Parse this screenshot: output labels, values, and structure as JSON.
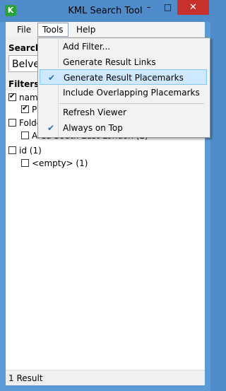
{
  "window": {
    "title": "KML Search Tool",
    "icon": "kml-app-icon",
    "controls": {
      "min": "–",
      "max": "□",
      "close": "✕"
    }
  },
  "menubar": {
    "items": [
      "File",
      "Tools",
      "Help"
    ]
  },
  "search": {
    "label": "Search",
    "value": "Belve"
  },
  "filters": {
    "label": "Filters",
    "tree": [
      {
        "label": "name",
        "checked": true,
        "level": 0
      },
      {
        "label": "P",
        "checked": true,
        "level": 1
      },
      {
        "label": "Folde",
        "checked": false,
        "level": 0
      },
      {
        "label": "Area South East London (1)",
        "checked": false,
        "level": 1
      },
      {
        "label": "id (1)",
        "checked": false,
        "level": 0
      },
      {
        "label": "<empty> (1)",
        "checked": false,
        "level": 1
      }
    ]
  },
  "tools_menu": {
    "items": [
      {
        "label": "Add Filter...",
        "checked": false
      },
      {
        "label": "Generate Result Links",
        "checked": false
      },
      {
        "label": "Generate Result Placemarks",
        "checked": true,
        "highlighted": true
      },
      {
        "label": "Include Overlapping Placemarks",
        "checked": false
      },
      {
        "label": "Refresh Viewer",
        "checked": false
      },
      {
        "label": "Always on Top",
        "checked": true
      }
    ]
  },
  "status": {
    "text": "1 Result"
  },
  "colors": {
    "titlebar": "#4f8cc9",
    "close_button": "#c7302d",
    "highlight": "#cde8ff",
    "check": "#2a6fb3"
  }
}
